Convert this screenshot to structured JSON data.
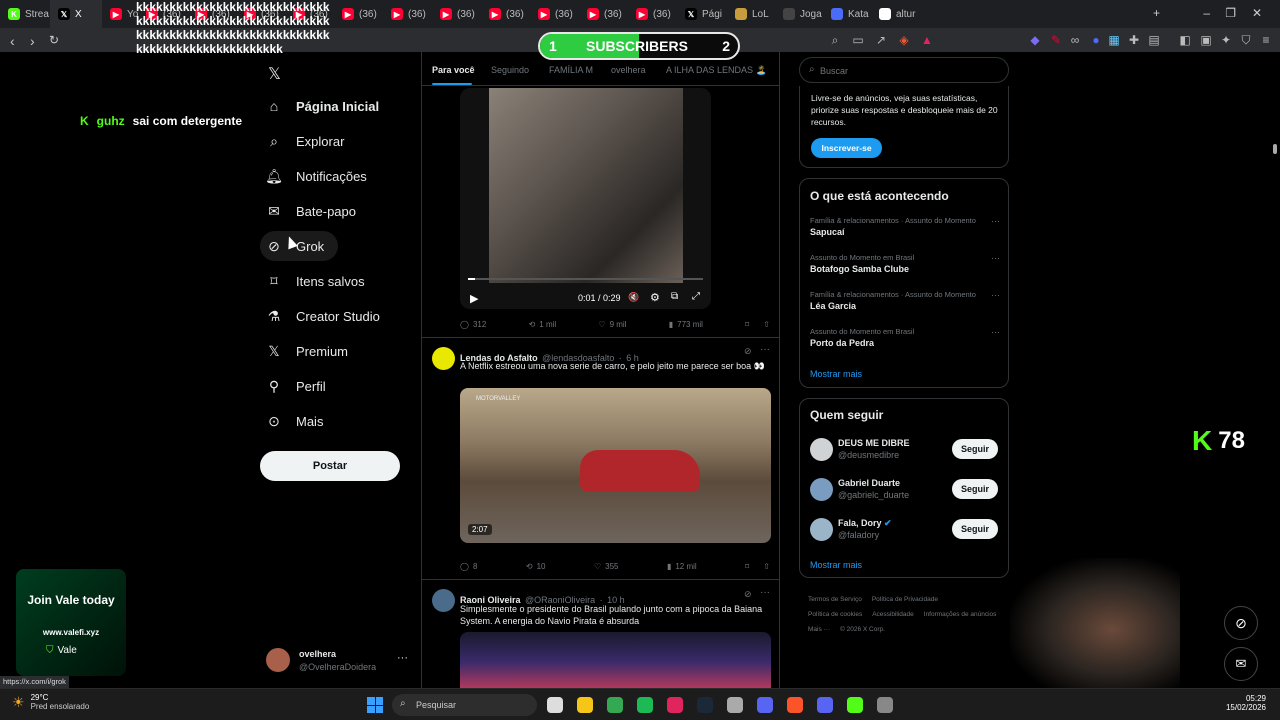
{
  "browser": {
    "tabs": [
      {
        "label": "Strea",
        "icon": "kick-icon",
        "color": "#53fc18"
      },
      {
        "label": "X",
        "icon": "x-logo-icon",
        "color": "#000000",
        "active": true
      },
      {
        "label": "Yo",
        "icon": "youtube-icon",
        "color": "#ff0033"
      },
      {
        "label": "(36)",
        "icon": "youtube-icon",
        "color": "#ff0033"
      },
      {
        "label": "(36)",
        "icon": "youtube-icon",
        "color": "#ff0033"
      },
      {
        "label": "(36)",
        "icon": "youtube-icon",
        "color": "#ff0033"
      },
      {
        "label": "(36)",
        "icon": "youtube-icon",
        "color": "#ff0033"
      },
      {
        "label": "(36)",
        "icon": "youtube-icon",
        "color": "#ff0033"
      },
      {
        "label": "(36)",
        "icon": "youtube-icon",
        "color": "#ff0033"
      },
      {
        "label": "(36)",
        "icon": "youtube-icon",
        "color": "#ff0033"
      },
      {
        "label": "(36)",
        "icon": "youtube-icon",
        "color": "#ff0033"
      },
      {
        "label": "(36)",
        "icon": "youtube-icon",
        "color": "#ff0033"
      },
      {
        "label": "(36)",
        "icon": "youtube-icon",
        "color": "#ff0033"
      },
      {
        "label": "(36)",
        "icon": "youtube-icon",
        "color": "#ff0033"
      },
      {
        "label": "Pági",
        "icon": "x-logo-icon",
        "color": "#000000"
      },
      {
        "label": "LoL",
        "icon": "lol-icon",
        "color": "#c89b3c"
      },
      {
        "label": "Joga",
        "icon": "game-icon",
        "color": "#444444"
      },
      {
        "label": "Kata",
        "icon": "kata-icon",
        "color": "#4a6cf7"
      },
      {
        "label": "altur",
        "icon": "google-icon",
        "color": "#ffffff"
      }
    ],
    "status_url": "https://x.com/i/grok"
  },
  "overlay": {
    "subscribers_label": "SUBSCRIBERS",
    "subscribers_left": "1",
    "subscribers_right": "2",
    "chat_spam": "kkkkkkkkkkkkkkkkkkkkkkkkkkkkkkkkkkkkkkkkkkkkkkkkkkkkkkkkkkkkkkkkkkkkkkkkkkkkkkkkkkkkkkkkkkkkkkkkkkkkkkkkkkkkk",
    "chat_user": "guhz",
    "chat_message": "sai com detergente",
    "viewer_count": "78",
    "join_title": "Join Vale today",
    "join_url": "www.valefi.xyz",
    "join_brand": "Vale"
  },
  "x_nav": {
    "items": [
      {
        "label": "Página Inicial",
        "icon": "home-icon",
        "bold": true
      },
      {
        "label": "Explorar",
        "icon": "search-icon"
      },
      {
        "label": "Notificações",
        "icon": "bell-icon"
      },
      {
        "label": "Bate-papo",
        "icon": "mail-icon"
      },
      {
        "label": "Grok",
        "icon": "grok-icon"
      },
      {
        "label": "Itens salvos",
        "icon": "bookmark-icon"
      },
      {
        "label": "Creator Studio",
        "icon": "flask-icon"
      },
      {
        "label": "Premium",
        "icon": "x-logo-icon"
      },
      {
        "label": "Perfil",
        "icon": "person-icon"
      },
      {
        "label": "Mais",
        "icon": "more-circle-icon"
      }
    ],
    "post_label": "Postar",
    "account_name": "ovelhera",
    "account_handle": "@OvelheraDoidera"
  },
  "feed": {
    "tabs": [
      "Para você",
      "Seguindo",
      "FAMÍLIA M",
      "ovelhera",
      "A ILHA DAS LENDAS 🏝️"
    ],
    "video1": {
      "time": "0:01 / 0:29",
      "replies": "312",
      "reposts": "1 mil",
      "likes": "9 mil",
      "views": "773 mil"
    },
    "tweet2": {
      "name": "Lendas do Asfalto",
      "handle": "@lendasdoasfalto",
      "time": "6 h",
      "text": "A Netflix estreou uma nova serie de carro, e pelo jeito me parece ser boa 👀",
      "video_duration": "2:07",
      "video_watermark": "MOTORVALLEY",
      "replies": "8",
      "reposts": "10",
      "likes": "355",
      "views": "12 mil"
    },
    "tweet3": {
      "name": "Raoni Oliveira",
      "handle": "@ORaoniOliveira",
      "time": "10 h",
      "text": "Simplesmente o presidente do Brasil pulando junto com a pipoca da Baiana System. A energia do Navio Pirata é absurda"
    }
  },
  "sidebar": {
    "search_placeholder": "Buscar",
    "premium_text": "Livre-se de anúncios, veja suas estatísticas, priorize suas respostas e desbloqueie mais de 20 recursos.",
    "premium_button": "Inscrever-se",
    "trends_title": "O que está acontecendo",
    "trends": [
      {
        "category": "Família & relacionamentos · Assunto do Momento",
        "title": "Sapucaí"
      },
      {
        "category": "Assunto do Momento em Brasil",
        "title": "Botafogo Samba Clube"
      },
      {
        "category": "Família & relacionamentos · Assunto do Momento",
        "title": "Léa Garcia"
      },
      {
        "category": "Assunto do Momento em Brasil",
        "title": "Porto da Pedra"
      }
    ],
    "show_more": "Mostrar mais",
    "follow_title": "Quem seguir",
    "follow": [
      {
        "name": "DEUS ME DIBRE",
        "handle": "@deusmedibre",
        "verified": false
      },
      {
        "name": "Gabriel Duarte",
        "handle": "@gabrielc_duarte",
        "verified": false
      },
      {
        "name": "Fala, Dory",
        "handle": "@faladory",
        "verified": true
      }
    ],
    "follow_button": "Seguir",
    "footer": [
      "Termos de Serviço",
      "Política de Privacidade",
      "Política de cookies",
      "Acessibilidade",
      "Informações de anúncios",
      "Mais ···",
      "© 2026 X Corp."
    ]
  },
  "taskbar": {
    "weather_temp": "29°C",
    "weather_desc": "Pred ensolarado",
    "search_placeholder": "Pesquisar",
    "time": "05:29",
    "date": "15/02/2026"
  }
}
